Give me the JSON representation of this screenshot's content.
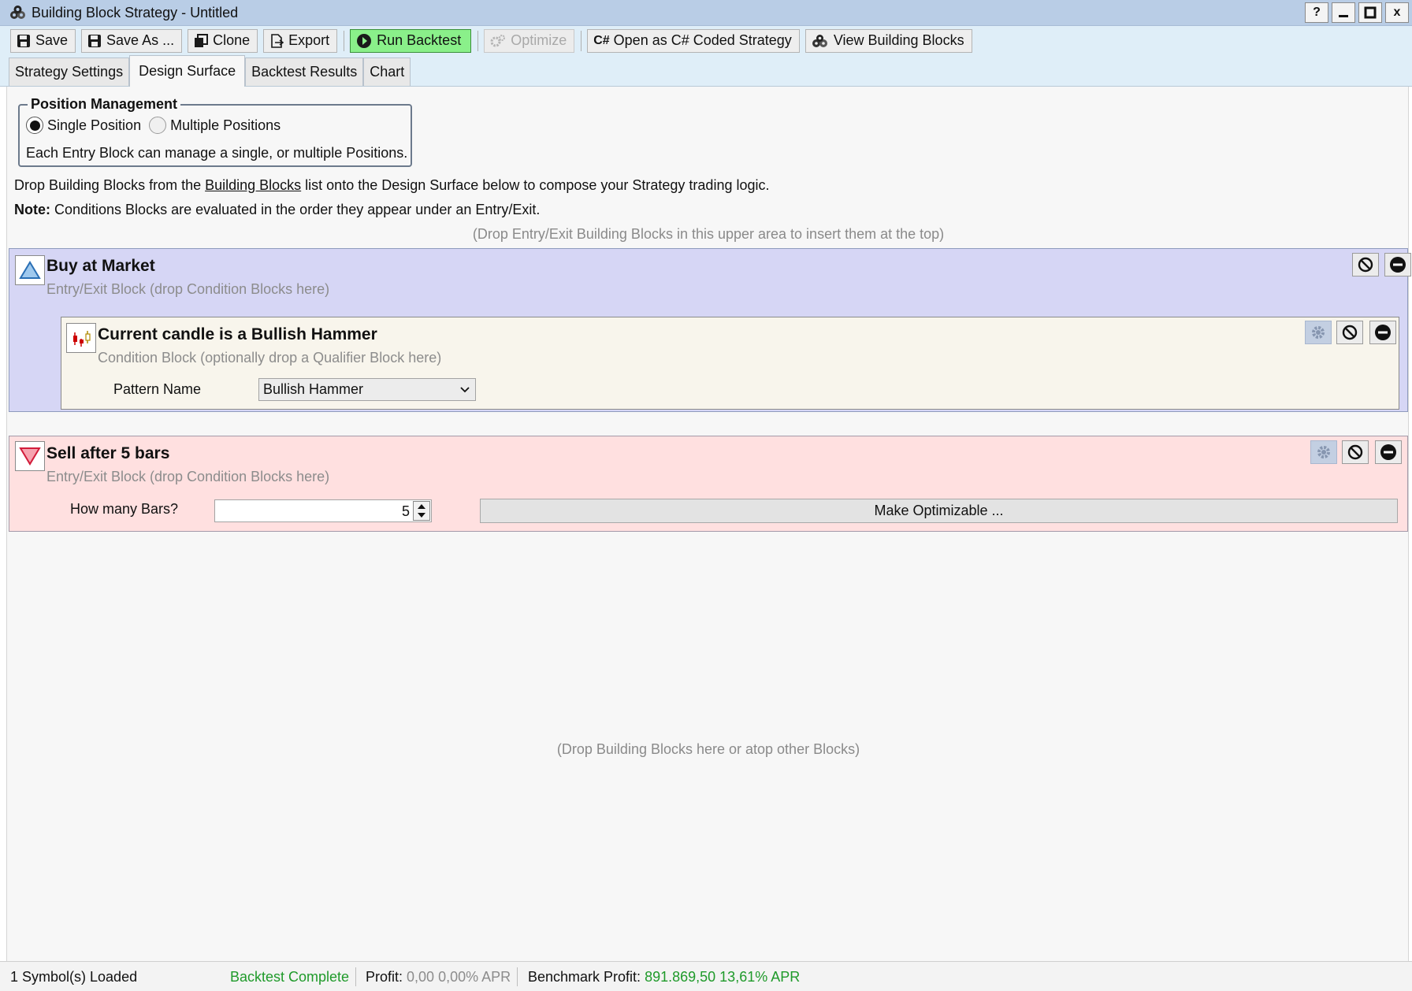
{
  "window": {
    "title": "Building Block Strategy - Untitled",
    "buttons": {
      "help": "?",
      "close": "x"
    }
  },
  "toolbar": {
    "save": "Save",
    "save_as": "Save As ...",
    "clone": "Clone",
    "export": "Export",
    "run_backtest": "Run Backtest",
    "optimize": "Optimize",
    "open_csharp": "Open as C# Coded Strategy",
    "view_blocks": "View Building Blocks",
    "csharp_badge": "C#"
  },
  "tabs": [
    {
      "label": "Strategy Settings"
    },
    {
      "label": "Design Surface"
    },
    {
      "label": "Backtest Results"
    },
    {
      "label": "Chart"
    }
  ],
  "active_tab": "Design Surface",
  "position_management": {
    "legend": "Position Management",
    "options": [
      "Single Position",
      "Multiple Positions"
    ],
    "selected": "Single Position",
    "description": "Each Entry Block can manage a single, or multiple Positions."
  },
  "hints": {
    "line1_pre": "Drop Building Blocks from the ",
    "line1_link": "Building Blocks",
    "line1_post": " list onto the Design Surface below to compose your Strategy trading logic.",
    "note_label": "Note:",
    "note_text": " Conditions Blocks are evaluated in the order they appear under an Entry/Exit.",
    "drop_top": "(Drop Entry/Exit Building Blocks in this upper area to insert them at the top)",
    "drop_bottom": "(Drop Building Blocks here or atop other Blocks)"
  },
  "blocks": {
    "buy": {
      "title": "Buy at Market",
      "subtitle": "Entry/Exit Block (drop Condition Blocks here)",
      "color": "#d6d6f5"
    },
    "condition": {
      "title": "Current candle is a Bullish Hammer",
      "subtitle": "Condition Block (optionally drop a Qualifier Block here)",
      "param_label": "Pattern Name",
      "param_value": "Bullish Hammer",
      "color": "#f8f5ec"
    },
    "sell": {
      "title": "Sell after 5 bars",
      "subtitle": "Entry/Exit Block (drop Condition Blocks here)",
      "param_label": "How many Bars?",
      "param_value": "5",
      "make_optimizable": "Make Optimizable ...",
      "color": "#ffe0e0"
    }
  },
  "statusbar": {
    "symbols": "1 Symbol(s) Loaded",
    "backtest_status": "Backtest Complete",
    "profit_label": "Profit:",
    "profit_value": "0,00 0,00% APR",
    "benchmark_label": "Benchmark Profit:",
    "benchmark_value": "891.869,50 13,61% APR"
  }
}
